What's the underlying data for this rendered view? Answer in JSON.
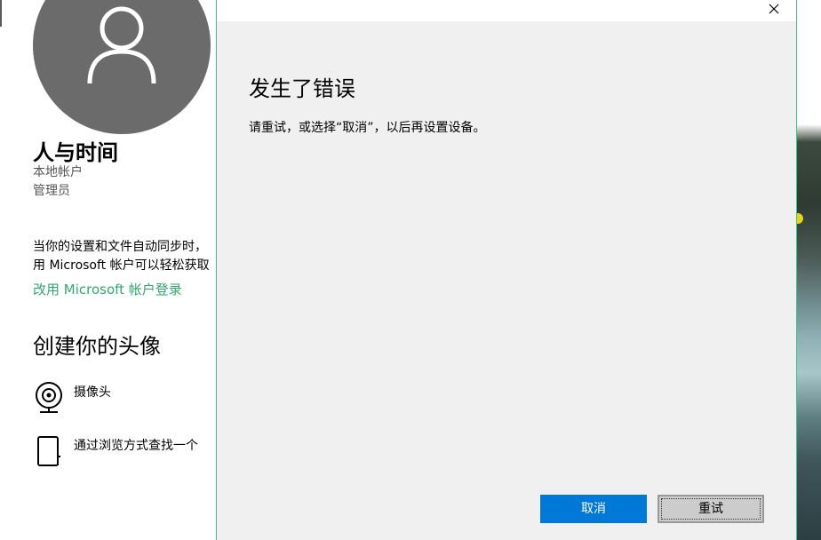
{
  "settings": {
    "user_name": "人与时间",
    "account_type": "本地帐户",
    "account_role": "管理员",
    "sync_desc_line1": "当你的设置和文件自动同步时，",
    "sync_desc_line2": "用 Microsoft 帐户可以轻松获取",
    "ms_link": "改用 Microsoft 帐户登录",
    "avatar_heading": "创建你的头像",
    "camera_label": "摄像头",
    "browse_label": "通过浏览方式查找一个"
  },
  "dialog": {
    "title": "发生了错误",
    "message": "请重试，或选择“取消”，以后再设置设备。",
    "cancel_label": "取消",
    "retry_label": "重试",
    "close_icon": "close-icon"
  },
  "colors": {
    "accent_link": "#2fa96c",
    "dialog_border": "#3fc48a",
    "primary_button": "#0078d7",
    "avatar_bg": "#6b6b6b"
  }
}
